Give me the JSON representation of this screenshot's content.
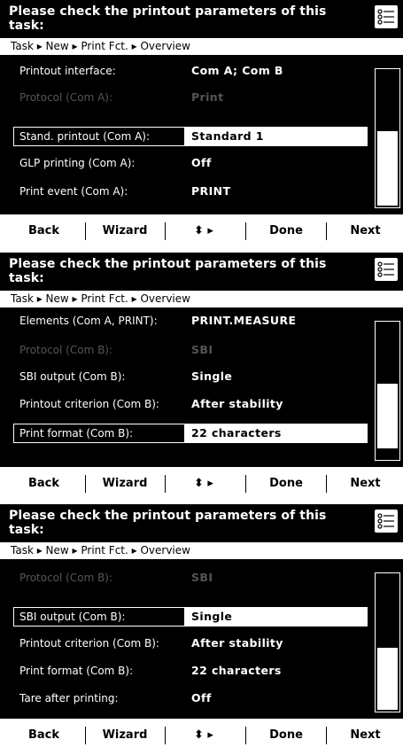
{
  "screens": [
    {
      "title": "Please check the printout parameters of this task:",
      "icon": "menu-list-icon",
      "breadcrumb": "Task ▸ New ▸ Print Fct. ▸ Overview",
      "rows": [
        {
          "label": "Printout interface:",
          "value": "Com A; Com B",
          "state": "normal"
        },
        {
          "label": "Protocol (Com A):",
          "value": "Print",
          "state": "disabled"
        },
        {
          "label": "Stand. printout (Com A):",
          "value": "Standard 1",
          "state": "selected"
        },
        {
          "label": "GLP printing (Com A):",
          "value": "Off",
          "state": "normal"
        },
        {
          "label": "Print event (Com A):",
          "value": "PRINT",
          "state": "normal"
        }
      ],
      "scroll_position": 0.55,
      "scroll_visible_fraction": 0.5,
      "softkeys": [
        "Back",
        "Wizard",
        "⬍ ▸",
        "Done",
        "Next"
      ]
    },
    {
      "title": "Please check the printout parameters of this task:",
      "icon": "menu-list-icon",
      "breadcrumb": "Task ▸ New ▸ Print Fct. ▸ Overview",
      "rows": [
        {
          "label": "Elements (Com A, PRINT):",
          "value": "PRINT.MEASURE",
          "state": "normal"
        },
        {
          "label": "Protocol (Com B):",
          "value": "SBI",
          "state": "disabled"
        },
        {
          "label": "SBI output (Com B):",
          "value": "Single",
          "state": "normal"
        },
        {
          "label": "Printout criterion (Com B):",
          "value": "After stability",
          "state": "normal"
        },
        {
          "label": "Print format (Com B):",
          "value": "22 characters",
          "state": "selected"
        }
      ],
      "scroll_position": 0.8,
      "scroll_visible_fraction": 0.5,
      "softkeys": [
        "Back",
        "Wizard",
        "⬍ ▸",
        "Done",
        "Next"
      ]
    },
    {
      "title": "Please check the printout parameters of this task:",
      "icon": "menu-list-icon",
      "breadcrumb": "Task ▸ New ▸ Print Fct. ▸ Overview",
      "rows": [
        {
          "label": "Protocol (Com B):",
          "value": "SBI",
          "state": "disabled"
        },
        {
          "label": "SBI output (Com B):",
          "value": "Single",
          "state": "selected"
        },
        {
          "label": "Printout criterion (Com B):",
          "value": "After stability",
          "state": "normal"
        },
        {
          "label": "Print format (Com B):",
          "value": "22 characters",
          "state": "normal"
        },
        {
          "label": "Tare after printing:",
          "value": "Off",
          "state": "normal"
        }
      ],
      "scroll_position": 1.0,
      "scroll_visible_fraction": 0.5,
      "softkeys": [
        "Back",
        "Wizard",
        "⬍ ▸",
        "Done",
        "Next"
      ]
    }
  ]
}
